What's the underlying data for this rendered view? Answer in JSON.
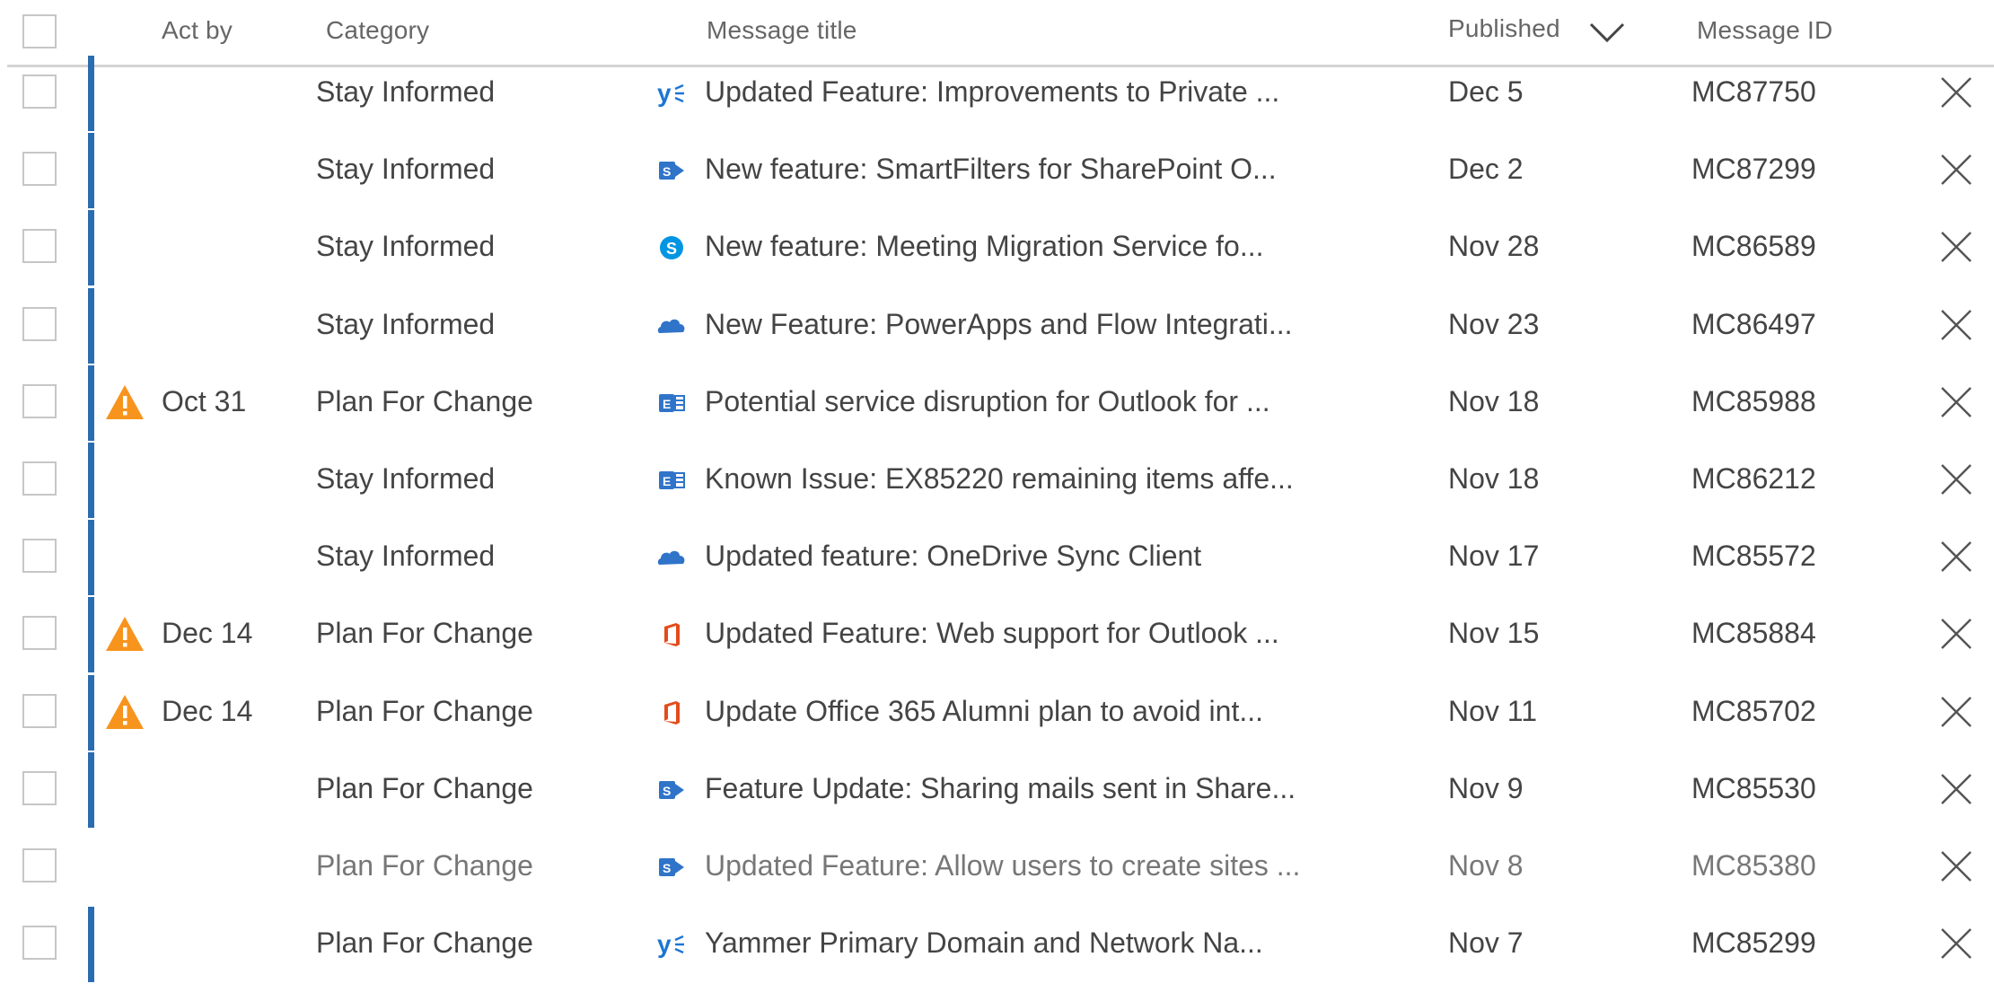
{
  "header": {
    "act_by": "Act by",
    "category": "Category",
    "message_title": "Message title",
    "published": "Published",
    "message_id": "Message ID"
  },
  "colors": {
    "unread_bar": "#2b6cb0",
    "warning": "#f7941d",
    "icon_blue": "#2f74c9",
    "office_orange": "#e34c1b",
    "yammer_blue": "#1d75d4",
    "skype_blue": "#0095e3"
  },
  "rows": [
    {
      "unread": true,
      "act_by": "",
      "warning": false,
      "category": "Stay Informed",
      "service_icon": "yammer-icon",
      "title": "Updated Feature: Improvements to Private ...",
      "published": "Dec 5",
      "message_id": "MC87750"
    },
    {
      "unread": true,
      "act_by": "",
      "warning": false,
      "category": "Stay Informed",
      "service_icon": "sharepoint-icon",
      "title": "New feature: SmartFilters for SharePoint O...",
      "published": "Dec 2",
      "message_id": "MC87299"
    },
    {
      "unread": true,
      "act_by": "",
      "warning": false,
      "category": "Stay Informed",
      "service_icon": "skype-icon",
      "title": "New feature: Meeting Migration Service fo...",
      "published": "Nov 28",
      "message_id": "MC86589"
    },
    {
      "unread": true,
      "act_by": "",
      "warning": false,
      "category": "Stay Informed",
      "service_icon": "onedrive-icon",
      "title": "New Feature: PowerApps and Flow Integrati...",
      "published": "Nov 23",
      "message_id": "MC86497"
    },
    {
      "unread": true,
      "act_by": "Oct 31",
      "warning": true,
      "category": "Plan For Change",
      "service_icon": "exchange-icon",
      "title": "Potential service disruption for Outlook for ...",
      "published": "Nov 18",
      "message_id": "MC85988"
    },
    {
      "unread": true,
      "act_by": "",
      "warning": false,
      "category": "Stay Informed",
      "service_icon": "exchange-icon",
      "title": "Known Issue: EX85220 remaining items affe...",
      "published": "Nov 18",
      "message_id": "MC86212"
    },
    {
      "unread": true,
      "act_by": "",
      "warning": false,
      "category": "Stay Informed",
      "service_icon": "onedrive-icon",
      "title": "Updated feature: OneDrive Sync Client",
      "published": "Nov 17",
      "message_id": "MC85572"
    },
    {
      "unread": true,
      "act_by": "Dec 14",
      "warning": true,
      "category": "Plan For Change",
      "service_icon": "office-icon",
      "title": "Updated Feature: Web support for Outlook ...",
      "published": "Nov 15",
      "message_id": "MC85884"
    },
    {
      "unread": true,
      "act_by": "Dec 14",
      "warning": true,
      "category": "Plan For Change",
      "service_icon": "office-icon",
      "title": "Update Office 365 Alumni plan to avoid int...",
      "published": "Nov 11",
      "message_id": "MC85702"
    },
    {
      "unread": true,
      "act_by": "",
      "warning": false,
      "category": "Plan For Change",
      "service_icon": "sharepoint-icon",
      "title": "Feature Update: Sharing mails sent in Share...",
      "published": "Nov 9",
      "message_id": "MC85530"
    },
    {
      "unread": false,
      "act_by": "",
      "warning": false,
      "category": "Plan For Change",
      "service_icon": "sharepoint-icon",
      "title": "Updated Feature: Allow users to create sites ...",
      "published": "Nov 8",
      "message_id": "MC85380"
    },
    {
      "unread": true,
      "act_by": "",
      "warning": false,
      "category": "Plan For Change",
      "service_icon": "yammer-icon",
      "title": "Yammer Primary Domain and Network Na...",
      "published": "Nov 7",
      "message_id": "MC85299"
    }
  ]
}
